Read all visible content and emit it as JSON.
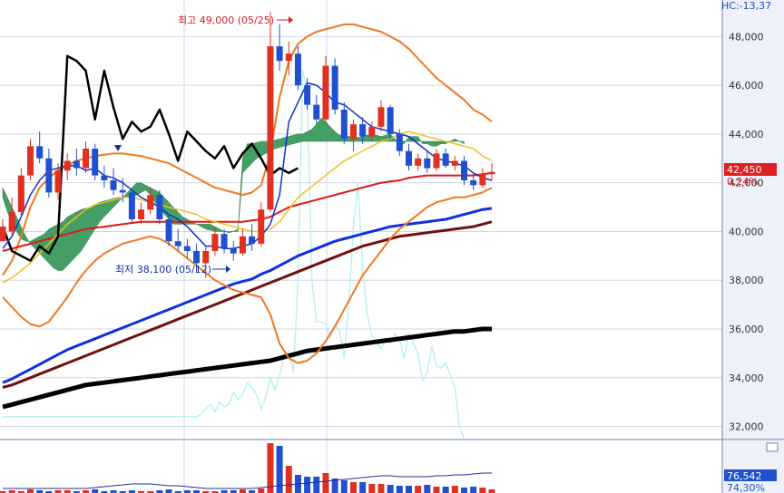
{
  "header": {
    "indicator_readout": "HC:-13,37"
  },
  "annotations": {
    "high_label": "최고 49,000 (05/25)",
    "low_label": "최저 38,100 (05/12)"
  },
  "price_axis": {
    "ticks": [
      "48,000",
      "46,000",
      "44,000",
      "42,000",
      "40,000",
      "38,000",
      "36,000",
      "34,000",
      "32,000"
    ],
    "current_price": "42,450",
    "current_change": "0,24%"
  },
  "volume_axis": {
    "current_volume": "76,542",
    "current_ratio": "74,30%"
  },
  "colors": {
    "up_candle": "#e03020",
    "down_candle": "#2050d0",
    "cloud": "#3a9a5c",
    "bollinger": "#f07820",
    "ma5": "#1030d0",
    "ma20": "#f0c020",
    "ma60": "#e01818",
    "ma120": "#1030e0",
    "ma240": "#701010",
    "ma480": "#000000",
    "lagging": "#000000",
    "psych": "#b8f0f0",
    "grid": "#d0d4e8",
    "axis_bg": "#eef0fa"
  },
  "chart_data": {
    "type": "candlestick",
    "ylim": [
      31500,
      49500
    ],
    "yticks": [
      48000,
      46000,
      44000,
      42000,
      40000,
      38000,
      36000,
      34000,
      32000
    ],
    "high": {
      "value": 49000,
      "index": 29
    },
    "low": {
      "value": 38100,
      "index": 22
    },
    "candles": [
      [
        39600,
        40500,
        40000,
        40200
      ],
      [
        40000,
        41400,
        39800,
        40800
      ],
      [
        40800,
        42600,
        40600,
        42300
      ],
      [
        42300,
        43800,
        42100,
        43500
      ],
      [
        43500,
        44100,
        42800,
        43000
      ],
      [
        43000,
        43400,
        41400,
        41600
      ],
      [
        41600,
        42800,
        41300,
        42500
      ],
      [
        42500,
        43200,
        42100,
        42900
      ],
      [
        42900,
        43400,
        42300,
        42600
      ],
      [
        42600,
        43700,
        42400,
        43400
      ],
      [
        43400,
        43600,
        42100,
        42300
      ],
      [
        42300,
        42700,
        41800,
        42100
      ],
      [
        42100,
        42600,
        41500,
        41700
      ],
      [
        41700,
        42200,
        41200,
        41600
      ],
      [
        41600,
        41700,
        40400,
        40500
      ],
      [
        40500,
        41200,
        40300,
        40900
      ],
      [
        40900,
        41800,
        40700,
        41500
      ],
      [
        41500,
        41700,
        40300,
        40500
      ],
      [
        40500,
        40700,
        39400,
        39600
      ],
      [
        39600,
        40100,
        39200,
        39400
      ],
      [
        39400,
        39700,
        38900,
        39200
      ],
      [
        39200,
        39500,
        38300,
        38700
      ],
      [
        38700,
        39400,
        38100,
        39200
      ],
      [
        39200,
        40200,
        39000,
        39900
      ],
      [
        39900,
        40100,
        39100,
        39300
      ],
      [
        39300,
        39600,
        38800,
        39100
      ],
      [
        39100,
        40100,
        39000,
        39800
      ],
      [
        39800,
        40300,
        39200,
        39500
      ],
      [
        39500,
        41200,
        39400,
        40900
      ],
      [
        40900,
        49000,
        40800,
        47600
      ],
      [
        47600,
        48500,
        46600,
        47000
      ],
      [
        47000,
        47800,
        46400,
        47300
      ],
      [
        47300,
        47600,
        45800,
        46000
      ],
      [
        46000,
        46300,
        45000,
        45200
      ],
      [
        45200,
        45600,
        44400,
        44600
      ],
      [
        44600,
        47200,
        44400,
        46800
      ],
      [
        46800,
        47100,
        44800,
        45000
      ],
      [
        45000,
        45300,
        43600,
        43800
      ],
      [
        43800,
        44600,
        43300,
        44400
      ],
      [
        44400,
        44700,
        43600,
        43900
      ],
      [
        43900,
        44500,
        43700,
        44300
      ],
      [
        44300,
        45400,
        44100,
        45100
      ],
      [
        45100,
        45200,
        43800,
        44000
      ],
      [
        44000,
        44200,
        43100,
        43300
      ],
      [
        43300,
        43600,
        42500,
        42700
      ],
      [
        42700,
        43200,
        42500,
        43000
      ],
      [
        43000,
        43300,
        42400,
        42600
      ],
      [
        42600,
        43400,
        42500,
        43200
      ],
      [
        43200,
        43400,
        42600,
        42700
      ],
      [
        42700,
        43100,
        42500,
        42900
      ],
      [
        42900,
        43100,
        41900,
        42100
      ],
      [
        42100,
        42400,
        41700,
        41900
      ],
      [
        41900,
        42600,
        41800,
        42350
      ],
      [
        42350,
        42800,
        42100,
        42450
      ]
    ],
    "ma5": [
      39300,
      39800,
      40600,
      41500,
      42100,
      42500,
      42600,
      42700,
      42700,
      42500,
      42600,
      42300,
      42200,
      42000,
      41700,
      41400,
      41200,
      41000,
      40700,
      40500,
      40200,
      39800,
      39400,
      39400,
      39300,
      39300,
      39400,
      39500,
      39800,
      40300,
      41500,
      44500,
      45300,
      46100,
      46000,
      45700,
      45300,
      45200,
      44900,
      44600,
      44300,
      44200,
      44100,
      44000,
      43900,
      43600,
      43300,
      43000,
      42900,
      42800,
      42700,
      42400,
      42200,
      42100
    ],
    "ma20": [
      37900,
      38100,
      38400,
      38700,
      39100,
      39500,
      39900,
      40300,
      40600,
      40900,
      41100,
      41200,
      41300,
      41400,
      41400,
      41300,
      41200,
      41100,
      41000,
      40900,
      40800,
      40700,
      40500,
      40400,
      40300,
      40200,
      40100,
      40000,
      40000,
      40100,
      40400,
      40900,
      41400,
      41700,
      42000,
      42300,
      42600,
      42900,
      43100,
      43300,
      43500,
      43700,
      43800,
      44000,
      44100,
      44000,
      43900,
      43800,
      43700,
      43600,
      43500,
      43400,
      43100,
      42900
    ],
    "ma60": [
      39200,
      39300,
      39400,
      39500,
      39600,
      39700,
      39800,
      39900,
      40000,
      40100,
      40150,
      40200,
      40250,
      40300,
      40350,
      40400,
      40400,
      40400,
      40400,
      40400,
      40400,
      40400,
      40400,
      40400,
      40400,
      40400,
      40400,
      40450,
      40500,
      40600,
      40800,
      41000,
      41100,
      41200,
      41300,
      41400,
      41500,
      41600,
      41700,
      41800,
      41900,
      42000,
      42050,
      42100,
      42200,
      42250,
      42300,
      42300,
      42300,
      42300,
      42300,
      42300,
      42350,
      42400
    ],
    "ma120": [
      33800,
      33950,
      34150,
      34350,
      34550,
      34750,
      34950,
      35150,
      35300,
      35450,
      35600,
      35750,
      35900,
      36050,
      36200,
      36350,
      36500,
      36650,
      36800,
      36950,
      37100,
      37250,
      37400,
      37550,
      37700,
      37850,
      37950,
      38050,
      38250,
      38400,
      38600,
      38800,
      39000,
      39150,
      39300,
      39450,
      39600,
      39700,
      39800,
      39900,
      40000,
      40100,
      40200,
      40250,
      40300,
      40350,
      40400,
      40450,
      40500,
      40600,
      40700,
      40800,
      40900,
      40950
    ],
    "ma240": [
      33600,
      33700,
      33850,
      34000,
      34150,
      34300,
      34450,
      34600,
      34750,
      34900,
      35050,
      35200,
      35350,
      35500,
      35650,
      35800,
      35950,
      36100,
      36250,
      36400,
      36550,
      36700,
      36850,
      37000,
      37150,
      37300,
      37450,
      37600,
      37750,
      37900,
      38050,
      38200,
      38350,
      38500,
      38650,
      38800,
      38950,
      39100,
      39250,
      39400,
      39500,
      39600,
      39700,
      39800,
      39850,
      39900,
      39950,
      40000,
      40050,
      40100,
      40150,
      40200,
      40300,
      40400
    ],
    "ma480": [
      32800,
      32900,
      33000,
      33100,
      33200,
      33300,
      33400,
      33500,
      33600,
      33700,
      33750,
      33800,
      33850,
      33900,
      33950,
      34000,
      34050,
      34100,
      34150,
      34200,
      34250,
      34300,
      34350,
      34400,
      34450,
      34500,
      34550,
      34600,
      34650,
      34700,
      34800,
      34900,
      35000,
      35100,
      35150,
      35200,
      35250,
      35300,
      35350,
      35400,
      35450,
      35500,
      35550,
      35600,
      35650,
      35700,
      35750,
      35800,
      35850,
      35900,
      35900,
      35950,
      36000,
      36000
    ],
    "bb_upper": [
      38200,
      38800,
      39800,
      41000,
      41800,
      42200,
      42500,
      42700,
      42900,
      43000,
      43100,
      43150,
      43200,
      43200,
      43150,
      43100,
      43000,
      42900,
      42800,
      42600,
      42400,
      42200,
      42000,
      41800,
      41700,
      41600,
      41500,
      41600,
      41900,
      43200,
      45500,
      47000,
      47700,
      48000,
      48200,
      48300,
      48400,
      48500,
      48500,
      48400,
      48300,
      48200,
      48000,
      47800,
      47500,
      47100,
      46700,
      46300,
      46000,
      45700,
      45400,
      45000,
      44800,
      44500
    ],
    "bb_lower": [
      37300,
      36900,
      36500,
      36200,
      36100,
      36300,
      36800,
      37300,
      37900,
      38400,
      38800,
      39100,
      39300,
      39500,
      39600,
      39700,
      39800,
      39700,
      39500,
      39200,
      38900,
      38600,
      38300,
      38000,
      37800,
      37600,
      37500,
      37400,
      37300,
      36600,
      35400,
      34800,
      34600,
      34700,
      35000,
      35500,
      36100,
      36800,
      37500,
      38200,
      38700,
      39200,
      39700,
      40100,
      40400,
      40700,
      41000,
      41200,
      41300,
      41400,
      41400,
      41500,
      41600,
      41800
    ],
    "lagging": [
      40200,
      39200,
      39000,
      38800,
      39400,
      39100,
      39800,
      47200,
      47000,
      46600,
      44600,
      46600,
      45100,
      43800,
      44500,
      44100,
      44300,
      45000,
      44000,
      42900,
      44100,
      43700,
      43300,
      43000,
      43500,
      42600,
      43200,
      43600,
      43000,
      42300,
      42600,
      42400,
      42600
    ],
    "cloud_a": [
      41400,
      40800,
      40400,
      40000,
      39700,
      39600,
      39600,
      39700,
      39800,
      39900,
      40100,
      40200,
      40300,
      40400,
      40600,
      40700,
      40800,
      40900,
      40950,
      41000,
      41100,
      41200,
      41250,
      41300,
      41350,
      41400,
      41400,
      41400,
      41400,
      41500,
      41600,
      41700,
      41500,
      41200,
      41000,
      40700,
      40500,
      40300,
      40300,
      40300,
      40300,
      40300,
      40300,
      40300,
      40300,
      40300,
      40200,
      40100,
      40000,
      39950,
      40000,
      40100,
      43000,
      43600,
      43600,
      43650,
      43700,
      43700,
      43750,
      43750,
      43800,
      43850,
      43900,
      43950,
      44000,
      44000,
      44100,
      44200,
      44400,
      44650,
      44500,
      44300,
      44100,
      43950,
      43950,
      43900,
      43900,
      43850,
      43900,
      43950,
      43950,
      43950,
      43900,
      43950,
      44000,
      43800,
      43600,
      43600,
      43900,
      43900,
      43900,
      43600,
      43600,
      43500,
      43500,
      43600,
      43600,
      43700,
      43800,
      43700,
      43600
    ],
    "cloud_b": [
      41800,
      41400,
      41000,
      40600,
      40200,
      39800,
      39500,
      39300,
      39100,
      38900,
      38700,
      38500,
      38400,
      38400,
      38600,
      38800,
      39000,
      39200,
      39500,
      39800,
      40100,
      40400,
      40600,
      40800,
      41000,
      41200,
      41400,
      41600,
      41800,
      42000,
      42000,
      41900,
      41800,
      41700,
      41600,
      41400,
      41200,
      41000,
      40800,
      40600,
      40500,
      40400,
      40300,
      40200,
      40100,
      40050,
      40000,
      40000,
      40000,
      40000,
      40000,
      40000,
      42400,
      42600,
      42800,
      43000,
      43100,
      43200,
      43300,
      43400,
      43450,
      43500,
      43550,
      43600,
      43650,
      43700,
      43700,
      43700,
      43700,
      43700,
      43700,
      43700,
      43700,
      43700,
      43700,
      43700,
      43700,
      43700,
      43700,
      43700,
      43700,
      43700,
      43700,
      43700,
      43700,
      43700,
      43700,
      43700,
      43700,
      43700,
      43700,
      43700,
      43700,
      43700,
      43700,
      43700,
      43700,
      43700,
      43700,
      43700,
      43700
    ],
    "psych": [
      32400,
      32400,
      32400,
      32400,
      32400,
      32400,
      32400,
      32400,
      32400,
      32400,
      32400,
      32400,
      32400,
      32400,
      32400,
      32400,
      32400,
      32400,
      32400,
      32400,
      32400,
      32400,
      32400,
      32400,
      32400,
      32400,
      32400,
      32400,
      32400,
      32400,
      32400,
      32400,
      32400,
      32400,
      32400,
      32400,
      32400,
      32400,
      32400,
      32400,
      32400,
      32400,
      32400,
      32500,
      32700,
      32900,
      32600,
      33000,
      32800,
      32900,
      33400,
      33100,
      33300,
      33800,
      33600,
      33300,
      32700,
      33200,
      34000,
      33500,
      34100,
      34900,
      35100,
      34200,
      38000,
      46600,
      45800,
      38000,
      36300,
      36300,
      36200,
      35700,
      36200,
      35900,
      34800,
      37000,
      40200,
      42000,
      38500,
      36600,
      35700,
      35500,
      35200,
      35600,
      35400,
      35800,
      35600,
      34800,
      35800,
      35400,
      35000,
      33900,
      34200,
      35300,
      34500,
      34400,
      34600,
      34100,
      33600,
      32000,
      31500
    ],
    "volume": [
      2,
      3,
      2,
      4,
      3,
      2,
      3,
      3,
      2,
      3,
      4,
      2,
      3,
      2,
      3,
      2,
      2,
      3,
      4,
      2,
      3,
      3,
      2,
      2,
      3,
      3,
      4,
      3,
      5,
      55,
      52,
      30,
      20,
      18,
      18,
      22,
      16,
      14,
      12,
      12,
      10,
      10,
      9,
      8,
      8,
      8,
      9,
      7,
      7,
      8,
      6,
      7,
      6,
      4
    ],
    "volume_up": [
      1,
      1,
      1,
      1,
      0,
      0,
      1,
      1,
      0,
      1,
      0,
      0,
      0,
      0,
      0,
      1,
      1,
      0,
      0,
      0,
      0,
      0,
      1,
      1,
      0,
      0,
      1,
      0,
      1,
      1,
      0,
      1,
      0,
      0,
      0,
      1,
      0,
      0,
      1,
      0,
      1,
      1,
      0,
      0,
      0,
      1,
      0,
      1,
      0,
      1,
      0,
      0,
      1,
      1
    ],
    "volume_ma": [
      5,
      5,
      5,
      5,
      5,
      5,
      5,
      5,
      5,
      5,
      6,
      7,
      8,
      9,
      10,
      10,
      10,
      9,
      8,
      8,
      7,
      6,
      5,
      5,
      5,
      5,
      5,
      5,
      6,
      7,
      8,
      9,
      10,
      11,
      12,
      13,
      14,
      15,
      16,
      17,
      18,
      19,
      19,
      18,
      18,
      18,
      18,
      19,
      19,
      20,
      20,
      21,
      22,
      22
    ]
  }
}
